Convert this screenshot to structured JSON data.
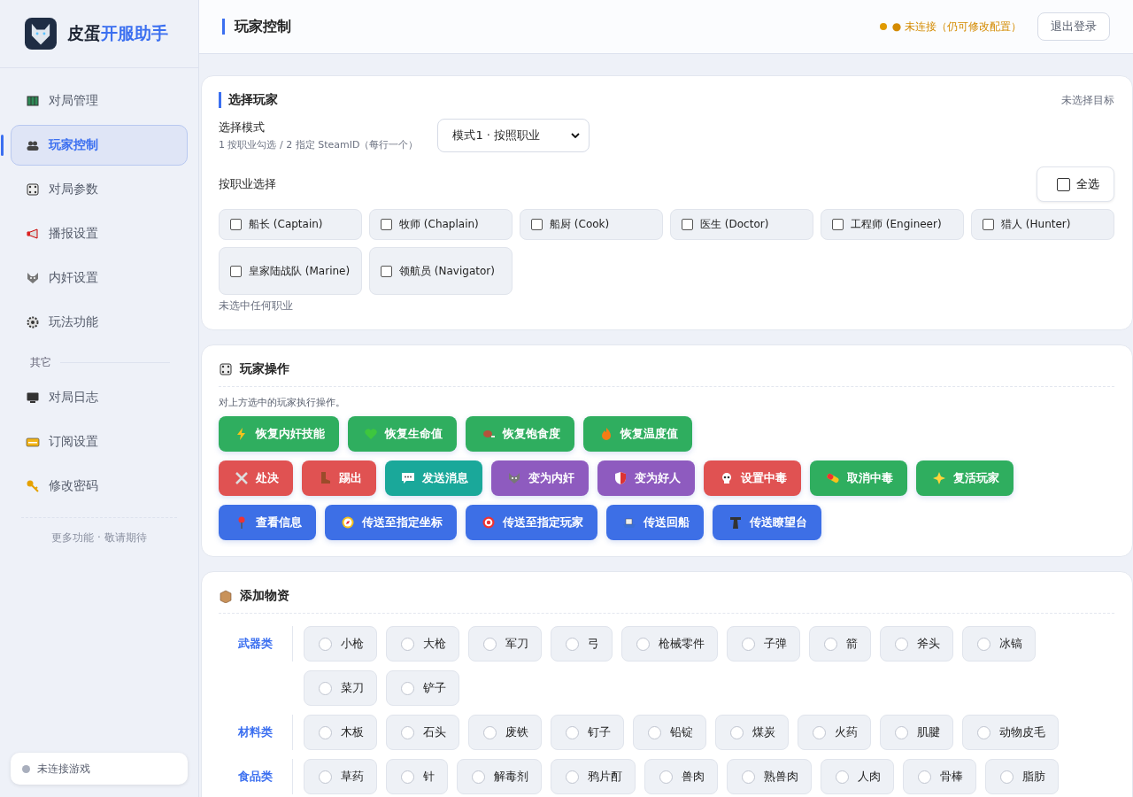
{
  "brand": {
    "name": "皮蛋",
    "accent": "开服助手"
  },
  "sidebar": {
    "items": [
      {
        "label": "对局管理",
        "selected": false
      },
      {
        "label": "玩家控制",
        "selected": true
      },
      {
        "label": "对局参数",
        "selected": false
      },
      {
        "label": "播报设置",
        "selected": false
      },
      {
        "label": "内奸设置",
        "selected": false
      },
      {
        "label": "玩法功能",
        "selected": false
      }
    ],
    "section_label": "其它",
    "other_items": [
      {
        "label": "对局日志",
        "selected": false
      },
      {
        "label": "订阅设置",
        "selected": false
      },
      {
        "label": "修改密码",
        "selected": false
      }
    ],
    "footer_note": "更多功能 · 敬请期待",
    "game_status": {
      "text": "未连接游戏",
      "connected": false
    }
  },
  "header": {
    "title": "玩家控制",
    "status": "● 未连接（仍可修改配置）",
    "connected": false,
    "logout": "退出登录"
  },
  "select_player": {
    "title": "选择玩家",
    "target": "未选择目标",
    "mode_label": "选择模式",
    "mode_hint": "1 按职业勾选 / 2 指定 SteamID（每行一个）",
    "mode_value": "模式1 · 按照职业",
    "job_label": "按职业选择",
    "select_all": {
      "label": "全选",
      "checked": false
    },
    "jobs": [
      {
        "label": "船长 (Captain)",
        "checked": false
      },
      {
        "label": "牧师 (Chaplain)",
        "checked": false
      },
      {
        "label": "船厨 (Cook)",
        "checked": false
      },
      {
        "label": "医生 (Doctor)",
        "checked": false
      },
      {
        "label": "工程师 (Engineer)",
        "checked": false
      },
      {
        "label": "猎人 (Hunter)",
        "checked": false
      },
      {
        "label": "皇家陆战队 (Marine)",
        "checked": false
      },
      {
        "label": "领航员 (Navigator)",
        "checked": false
      }
    ],
    "note": "未选中任何职业"
  },
  "player_actions": {
    "title": "玩家操作",
    "description": "对上方选中的玩家执行操作。",
    "recovery_buttons": [
      {
        "label": "恢复内奸技能",
        "color": "#2fae5f"
      },
      {
        "label": "恢复生命值",
        "color": "#2fae5f"
      },
      {
        "label": "恢复饱食度",
        "color": "#2fae5f"
      },
      {
        "label": "恢复温度值",
        "color": "#2fae5f"
      }
    ],
    "control_buttons": [
      {
        "label": "处决",
        "color": "#e05252"
      },
      {
        "label": "踢出",
        "color": "#e05252"
      },
      {
        "label": "发送消息",
        "color": "#1aa89a"
      },
      {
        "label": "变为内奸",
        "color": "#8e5bbf"
      },
      {
        "label": "变为好人",
        "color": "#8e5bbf"
      },
      {
        "label": "设置中毒",
        "color": "#e05252"
      },
      {
        "label": "取消中毒",
        "color": "#2fae5f"
      },
      {
        "label": "复活玩家",
        "color": "#2fae5f"
      }
    ],
    "teleport_buttons": [
      {
        "label": "查看信息",
        "color": "#3d6fe6"
      },
      {
        "label": "传送至指定坐标",
        "color": "#3d6fe6"
      },
      {
        "label": "传送至指定玩家",
        "color": "#3d6fe6"
      },
      {
        "label": "传送回船",
        "color": "#3d6fe6"
      },
      {
        "label": "传送瞭望台",
        "color": "#3d6fe6"
      }
    ]
  },
  "add_items": {
    "title": "添加物资",
    "categories": [
      {
        "name": "武器类",
        "items": [
          {
            "label": "小枪",
            "selected": false
          },
          {
            "label": "大枪",
            "selected": false
          },
          {
            "label": "军刀",
            "selected": false
          },
          {
            "label": "弓",
            "selected": false
          },
          {
            "label": "枪械零件",
            "selected": false
          },
          {
            "label": "子弹",
            "selected": false
          },
          {
            "label": "箭",
            "selected": false
          },
          {
            "label": "斧头",
            "selected": false
          },
          {
            "label": "冰镐",
            "selected": false
          },
          {
            "label": "菜刀",
            "selected": false
          },
          {
            "label": "铲子",
            "selected": false
          }
        ]
      },
      {
        "name": "材料类",
        "items": [
          {
            "label": "木板",
            "selected": false
          },
          {
            "label": "石头",
            "selected": false
          },
          {
            "label": "废铁",
            "selected": false
          },
          {
            "label": "钉子",
            "selected": false
          },
          {
            "label": "铅锭",
            "selected": false
          },
          {
            "label": "煤炭",
            "selected": false
          },
          {
            "label": "火药",
            "selected": false
          },
          {
            "label": "肌腱",
            "selected": false
          },
          {
            "label": "动物皮毛",
            "selected": false
          }
        ]
      },
      {
        "name": "食品类",
        "items": [
          {
            "label": "草药",
            "selected": false
          },
          {
            "label": "针",
            "selected": false
          },
          {
            "label": "解毒剂",
            "selected": false
          },
          {
            "label": "鸦片酊",
            "selected": false
          },
          {
            "label": "兽肉",
            "selected": false
          },
          {
            "label": "熟兽肉",
            "selected": false
          },
          {
            "label": "人肉",
            "selected": false
          },
          {
            "label": "骨棒",
            "selected": false
          },
          {
            "label": "脂肪",
            "selected": false
          }
        ]
      }
    ]
  }
}
